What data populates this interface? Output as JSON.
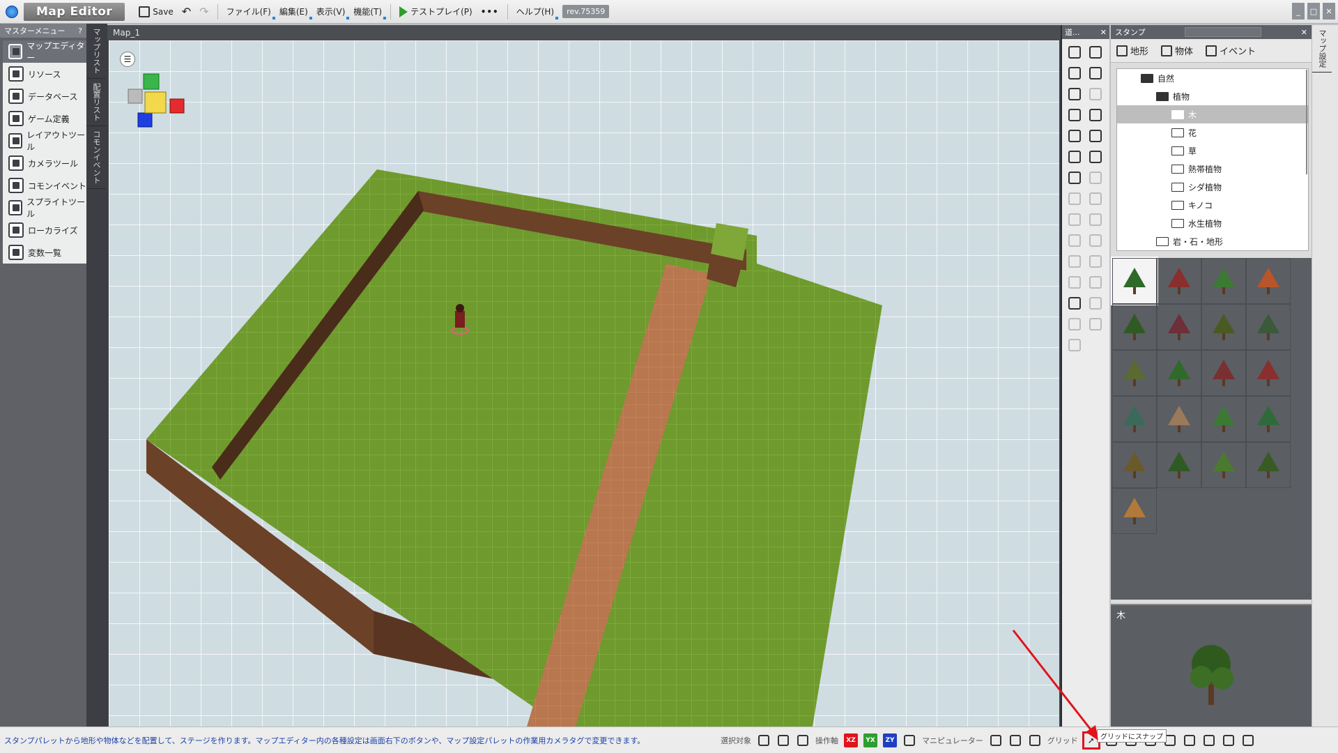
{
  "app": {
    "title": "Map Editor",
    "revision": "rev.75359"
  },
  "toolbar": {
    "save_label": "Save",
    "menus": [
      "ファイル(F)",
      "編集(E)",
      "表示(V)",
      "機能(T)"
    ],
    "testplay_label": "テストプレイ(P)",
    "more_label": "•••",
    "help_label": "ヘルプ(H)"
  },
  "master_menu": {
    "title": "マスターメニュー",
    "help": "?",
    "items": [
      {
        "label": "マップエディター",
        "active": true
      },
      {
        "label": "リソース"
      },
      {
        "label": "データベース"
      },
      {
        "label": "ゲーム定義"
      },
      {
        "label": "レイアウトツール"
      },
      {
        "label": "カメラツール"
      },
      {
        "label": "コモンイベント"
      },
      {
        "label": "スプライトツール"
      },
      {
        "label": "ローカライズ"
      },
      {
        "label": "変数一覧"
      }
    ]
  },
  "side_tabs": [
    "マップリスト",
    "配置リスト",
    "コモンイベント"
  ],
  "viewport": {
    "map_name": "Map_1"
  },
  "tool_panel": {
    "title": "道..."
  },
  "stamp_panel": {
    "title": "スタンプ",
    "tabs": [
      "地形",
      "物体",
      "イベント"
    ],
    "tree": [
      {
        "label": "自然",
        "depth": 1,
        "open": true
      },
      {
        "label": "植物",
        "depth": 2,
        "open": true
      },
      {
        "label": "木",
        "depth": 3,
        "selected": true
      },
      {
        "label": "花",
        "depth": 3
      },
      {
        "label": "草",
        "depth": 3
      },
      {
        "label": "熱帯植物",
        "depth": 3
      },
      {
        "label": "シダ植物",
        "depth": 3
      },
      {
        "label": "キノコ",
        "depth": 3
      },
      {
        "label": "水生植物",
        "depth": 3
      },
      {
        "label": "岩・石・地形",
        "depth": 2
      }
    ],
    "preview_title": "木"
  },
  "right_strip": {
    "label": "マップ設定"
  },
  "statusbar": {
    "message": "スタンプパレットから地形や物体などを配置して、ステージを作ります。マップエディター内の各種設定は画面右下のボタンや、マップ設定パレットの作業用カメラタグで変更できます。",
    "select_target_label": "選択対象",
    "axis_label": "操作軸",
    "axis_xz": "XZ",
    "axis_yx": "YX",
    "axis_zy": "ZY",
    "manipulator_label": "マニピュレーター",
    "grid_label": "グリッド",
    "snap_tooltip": "グリッドにスナップ"
  },
  "colors": {
    "grass": "#6f9a2e",
    "dirt": "#8a5a3a",
    "path": "#b8774e",
    "accent_red": "#e0141a",
    "status_text": "#1b3fa8"
  }
}
